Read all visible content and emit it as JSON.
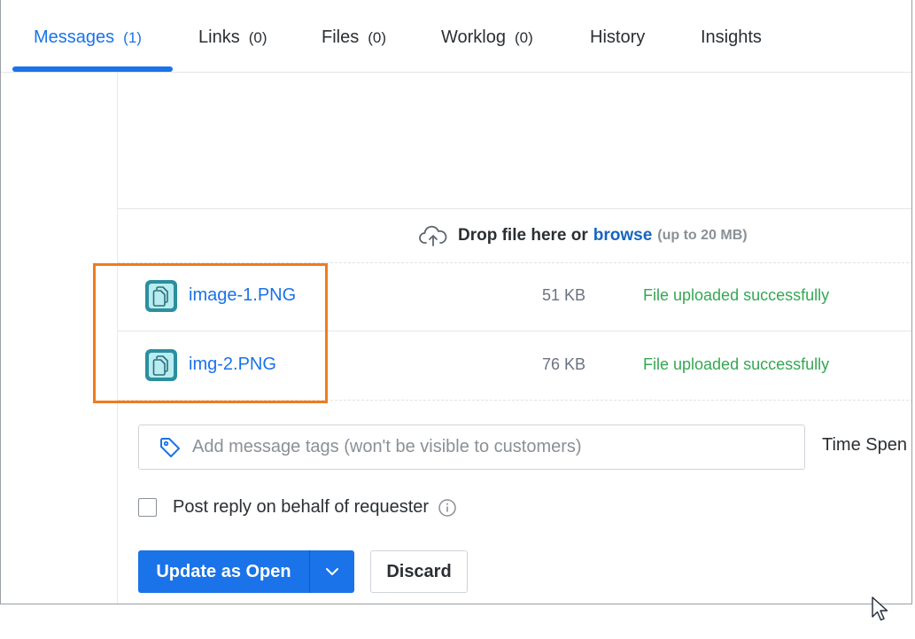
{
  "tabs": [
    {
      "label": "Messages",
      "count": "(1)"
    },
    {
      "label": "Links",
      "count": "(0)"
    },
    {
      "label": "Files",
      "count": "(0)"
    },
    {
      "label": "Worklog",
      "count": "(0)"
    },
    {
      "label": "History",
      "count": ""
    },
    {
      "label": "Insights",
      "count": ""
    }
  ],
  "active_tab": "Messages",
  "dropzone": {
    "text": "Drop file here or",
    "browse_label": "browse",
    "limit": "(up to 20 MB)",
    "icon": "cloud-upload-icon"
  },
  "files": [
    {
      "name": "image-1.PNG",
      "size": "51 KB",
      "status": "File uploaded successfully",
      "icon": "file-copy-icon"
    },
    {
      "name": "img-2.PNG",
      "size": "76 KB",
      "status": "File uploaded successfully",
      "icon": "file-copy-icon"
    }
  ],
  "tags": {
    "placeholder": "Add message tags (won't be visible to customers)",
    "value": "",
    "icon": "tag-icon"
  },
  "time_spent_label": "Time Spen",
  "post_on_behalf": {
    "label": "Post reply on behalf of requester",
    "checked": false
  },
  "actions": {
    "primary_label": "Update as Open",
    "discard_label": "Discard"
  },
  "colors": {
    "accent": "#1a73e8",
    "success": "#34a853",
    "highlight": "#f07b1d",
    "file_icon": "#2b8f9e"
  }
}
